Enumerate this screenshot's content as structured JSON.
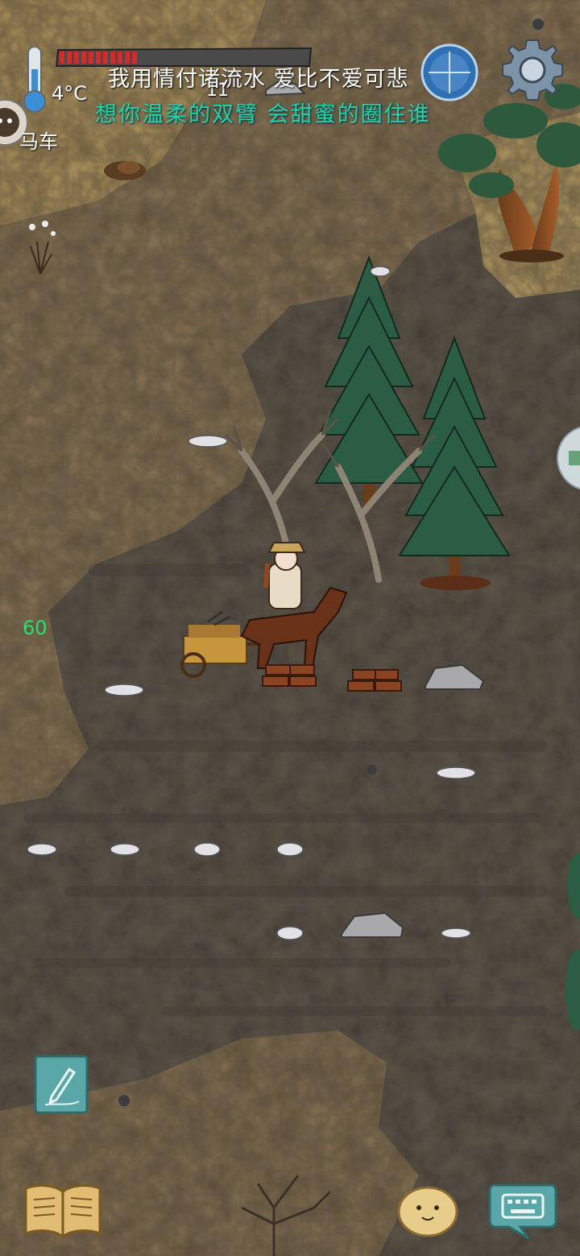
{
  "hud": {
    "temperature": "4°C",
    "health_count": "11",
    "health_fill": 0.32,
    "wagon_label": "马车",
    "fps": "60"
  },
  "lyrics": {
    "line1": "我用情付诸流水 爱比不爱可悲",
    "line2": "想你温柔的双臂 会甜蜜的圈住谁"
  },
  "icons": {
    "thermometer": "thermometer-icon",
    "compass": "compass-icon",
    "settings": "gear-icon",
    "avatar": "avatar-icon",
    "side": "side-bubble-icon",
    "note": "pencil-icon",
    "journal": "journal-icon",
    "emote": "potato-face-icon",
    "chat": "keyboard-icon"
  },
  "colors": {
    "lyric2": "#1fd6a4",
    "fps": "#23e36c",
    "health": "#d62a2a"
  }
}
